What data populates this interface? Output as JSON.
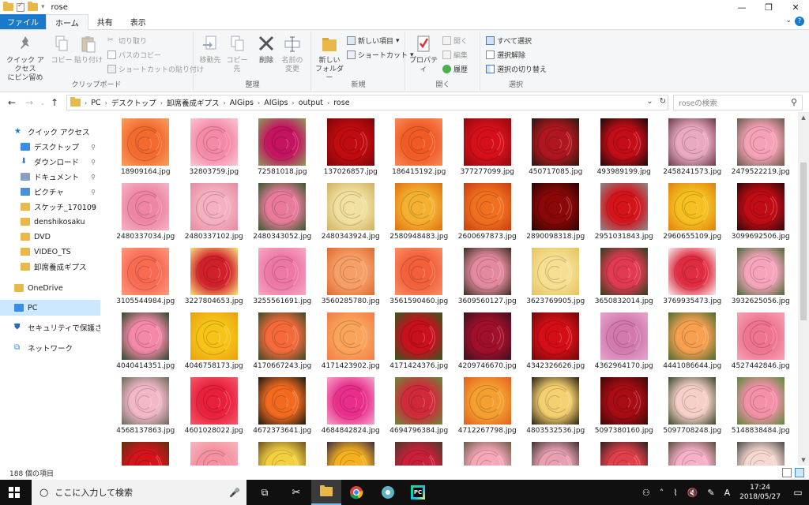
{
  "window": {
    "title": "rose",
    "minimize_glyph": "—",
    "maximize_glyph": "❐",
    "close_glyph": "✕"
  },
  "ribbon_tabs": [
    "ファイル",
    "ホーム",
    "共有",
    "表示"
  ],
  "ribbon": {
    "clipboard": {
      "group_label": "クリップボード",
      "pin_label_1": "クイック アクセス",
      "pin_label_2": "にピン留め",
      "copy_label": "コピー",
      "paste_label": "貼り付け",
      "cut_label": "切り取り",
      "copy_path_label": "パスのコピー",
      "paste_shortcut_label": "ショートカットの貼り付け"
    },
    "organize": {
      "group_label": "整理",
      "move_to_label": "移動先",
      "copy_to_label": "コピー先",
      "delete_label": "削除",
      "rename_label_1": "名前の",
      "rename_label_2": "変更"
    },
    "new": {
      "group_label": "新規",
      "new_folder_label_1": "新しい",
      "new_folder_label_2": "フォルダー",
      "new_item_label": "新しい項目",
      "shortcut_label": "ショートカット"
    },
    "open": {
      "group_label": "開く",
      "properties_label": "プロパティ",
      "open_label": "開く",
      "edit_label": "編集",
      "history_label": "履歴"
    },
    "select": {
      "group_label": "選択",
      "select_all_label": "すべて選択",
      "select_none_label": "選択解除",
      "invert_label": "選択の切り替え"
    }
  },
  "address": {
    "crumbs": [
      "PC",
      "デスクトップ",
      "卸席養成ギプス",
      "AIGips",
      "AIGips",
      "output",
      "rose"
    ],
    "search_placeholder": "roseの検索"
  },
  "nav_pane": {
    "items": [
      {
        "label": "クイック アクセス",
        "icon": "star-icon",
        "pinned": false
      },
      {
        "label": "デスクトップ",
        "icon": "desktop-icon",
        "pinned": true
      },
      {
        "label": "ダウンロード",
        "icon": "download-icon",
        "pinned": true
      },
      {
        "label": "ドキュメント",
        "icon": "document-icon",
        "pinned": true
      },
      {
        "label": "ピクチャ",
        "icon": "pictures-icon",
        "pinned": true
      },
      {
        "label": "スケッチ_170109",
        "icon": "folder-icon",
        "pinned": true
      },
      {
        "label": "denshikosaku",
        "icon": "folder-icon",
        "pinned": false
      },
      {
        "label": "DVD",
        "icon": "folder-icon",
        "pinned": false
      },
      {
        "label": "VIDEO_TS",
        "icon": "folder-icon",
        "pinned": false
      },
      {
        "label": "卸席養成ギプス",
        "icon": "folder-icon",
        "pinned": false
      },
      {
        "label": "OneDrive",
        "icon": "onedrive-icon",
        "pinned": false
      },
      {
        "label": "PC",
        "icon": "pc-icon",
        "pinned": false
      },
      {
        "label": "セキュリティで保護された",
        "icon": "shield-icon",
        "pinned": false
      },
      {
        "label": "ネットワーク",
        "icon": "network-icon",
        "pinned": false
      }
    ],
    "pin_glyph": "📌"
  },
  "files": [
    {
      "name": "18909164.jpg",
      "c1": "#f26a2e",
      "c2": "#f8a062"
    },
    {
      "name": "32803759.jpg",
      "c1": "#f48aa6",
      "c2": "#fbc6d4"
    },
    {
      "name": "72581018.jpg",
      "c1": "#c4135f",
      "c2": "#8e9b5a"
    },
    {
      "name": "137026857.jpg",
      "c1": "#c00c10",
      "c2": "#7a0508"
    },
    {
      "name": "186415192.jpg",
      "c1": "#f05a25",
      "c2": "#f68a5a"
    },
    {
      "name": "377277099.jpg",
      "c1": "#d6101a",
      "c2": "#8e0a10"
    },
    {
      "name": "450717085.jpg",
      "c1": "#b0161e",
      "c2": "#2a1a10"
    },
    {
      "name": "493989199.jpg",
      "c1": "#c30d18",
      "c2": "#1a0a0a"
    },
    {
      "name": "2458241573.jpg",
      "c1": "#e9a9c1",
      "c2": "#6a3a4a"
    },
    {
      "name": "2479522219.jpg",
      "c1": "#f5a2b6",
      "c2": "#6a5a4a"
    },
    {
      "name": "2480337034.jpg",
      "c1": "#ee86a2",
      "c2": "#f5b5c6"
    },
    {
      "name": "2480337102.jpg",
      "c1": "#f4b1c0",
      "c2": "#e58aa0"
    },
    {
      "name": "2480343052.jpg",
      "c1": "#e97a9c",
      "c2": "#355a2a"
    },
    {
      "name": "2480343924.jpg",
      "c1": "#f1e0a0",
      "c2": "#d0b060"
    },
    {
      "name": "2580948483.jpg",
      "c1": "#f4b030",
      "c2": "#e07010"
    },
    {
      "name": "2600697873.jpg",
      "c1": "#f07020",
      "c2": "#c83c10"
    },
    {
      "name": "2890098318.jpg",
      "c1": "#8a0808",
      "c2": "#2a0404"
    },
    {
      "name": "2951031843.jpg",
      "c1": "#d4141a",
      "c2": "#8a8a8a"
    },
    {
      "name": "2960655109.jpg",
      "c1": "#f5c020",
      "c2": "#e08010"
    },
    {
      "name": "3099692506.jpg",
      "c1": "#c00c14",
      "c2": "#300808"
    },
    {
      "name": "3105544984.jpg",
      "c1": "#f86a52",
      "c2": "#fb9a80"
    },
    {
      "name": "3227804653.jpg",
      "c1": "#d0202a",
      "c2": "#f8e080"
    },
    {
      "name": "3255561691.jpg",
      "c1": "#ee78a4",
      "c2": "#f6aac6"
    },
    {
      "name": "3560285780.jpg",
      "c1": "#f6a068",
      "c2": "#e06a30"
    },
    {
      "name": "3561590460.jpg",
      "c1": "#f2603a",
      "c2": "#f89068"
    },
    {
      "name": "3609560127.jpg",
      "c1": "#e48aa0",
      "c2": "#3a3020"
    },
    {
      "name": "3623769905.jpg",
      "c1": "#f4e090",
      "c2": "#e8c060"
    },
    {
      "name": "3650832014.jpg",
      "c1": "#e23a52",
      "c2": "#2a4020"
    },
    {
      "name": "3769935473.jpg",
      "c1": "#e02c40",
      "c2": "#f6f0f0"
    },
    {
      "name": "3932625056.jpg",
      "c1": "#f6a4bc",
      "c2": "#4a6a3a"
    },
    {
      "name": "4040414351.jpg",
      "c1": "#f388a8",
      "c2": "#2a4a2a"
    },
    {
      "name": "4046758173.jpg",
      "c1": "#f6c418",
      "c2": "#e8a010"
    },
    {
      "name": "4170667243.jpg",
      "c1": "#f46a3a",
      "c2": "#3a4a2a"
    },
    {
      "name": "4171423902.jpg",
      "c1": "#f9a45a",
      "c2": "#f47a4a"
    },
    {
      "name": "4171424376.jpg",
      "c1": "#c8101e",
      "c2": "#305a20"
    },
    {
      "name": "4209746670.jpg",
      "c1": "#a0102a",
      "c2": "#3a1020"
    },
    {
      "name": "4342326626.jpg",
      "c1": "#d40e16",
      "c2": "#6a0a0a"
    },
    {
      "name": "4362964170.jpg",
      "c1": "#d27ab0",
      "c2": "#e6a6cc"
    },
    {
      "name": "4441086644.jpg",
      "c1": "#f6a050",
      "c2": "#4a6a30"
    },
    {
      "name": "4527442846.jpg",
      "c1": "#ee7490",
      "c2": "#f6a4b6"
    },
    {
      "name": "4568137863.jpg",
      "c1": "#f2b8c8",
      "c2": "#6a6a5a"
    },
    {
      "name": "4601028022.jpg",
      "c1": "#e8203c",
      "c2": "#f45a6a"
    },
    {
      "name": "4672373641.jpg",
      "c1": "#f26a20",
      "c2": "#1a1a10"
    },
    {
      "name": "4684842824.jpg",
      "c1": "#e82e8a",
      "c2": "#f6a4cc"
    },
    {
      "name": "4694796384.jpg",
      "c1": "#d02a3a",
      "c2": "#6a8a3a"
    },
    {
      "name": "4712267798.jpg",
      "c1": "#f4a030",
      "c2": "#e06020"
    },
    {
      "name": "4803532536.jpg",
      "c1": "#f4d070",
      "c2": "#2a2010"
    },
    {
      "name": "5097380160.jpg",
      "c1": "#a80c14",
      "c2": "#3a0808"
    },
    {
      "name": "5097708248.jpg",
      "c1": "#f6d0c8",
      "c2": "#3a4a2a"
    },
    {
      "name": "5148838484.jpg",
      "c1": "#f490a8",
      "c2": "#5a8a3a"
    },
    {
      "name": "",
      "c1": "#d4141a",
      "c2": "#5a3010"
    },
    {
      "name": "",
      "c1": "#f490a0",
      "c2": "#f6b8c0"
    },
    {
      "name": "",
      "c1": "#f4d040",
      "c2": "#6a5020"
    },
    {
      "name": "",
      "c1": "#f4b020",
      "c2": "#3a2a40"
    },
    {
      "name": "",
      "c1": "#c8203a",
      "c2": "#4a3a2a"
    },
    {
      "name": "",
      "c1": "#f6a8b8",
      "c2": "#6a5a4a"
    },
    {
      "name": "",
      "c1": "#e8a0b0",
      "c2": "#3a3030"
    },
    {
      "name": "",
      "c1": "#e0404a",
      "c2": "#2a2020"
    },
    {
      "name": "",
      "c1": "#f6b0c8",
      "c2": "#5a4a3a"
    },
    {
      "name": "",
      "c1": "#f6d8d0",
      "c2": "#4a4a4a"
    }
  ],
  "status": {
    "item_count": "188 個の項目"
  },
  "taskbar": {
    "search_placeholder": "ここに入力して検索",
    "time": "17:24",
    "date": "2018/05/27",
    "ime": "A"
  },
  "colors": {
    "accent": "#1979ca",
    "selection": "#cce8ff",
    "taskbar_bg": "#101010"
  }
}
